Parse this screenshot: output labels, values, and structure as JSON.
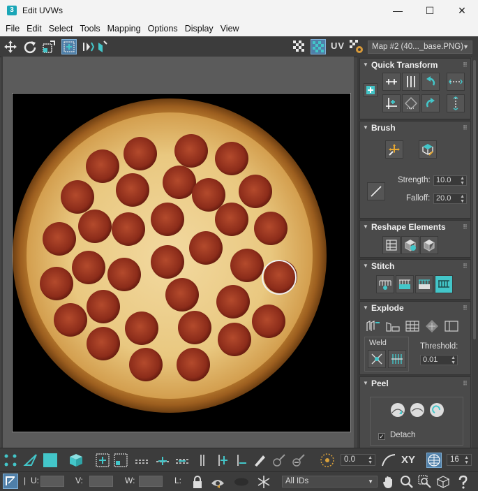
{
  "window": {
    "title": "Edit UVWs",
    "app_icon_glyph": "3",
    "minimize_glyph": "—",
    "maximize_glyph": "☐",
    "close_glyph": "✕"
  },
  "menu": [
    "File",
    "Edit",
    "Select",
    "Tools",
    "Mapping",
    "Options",
    "Display",
    "View"
  ],
  "toolbar_top": {
    "uv_label": "UV",
    "map_select": "Map #2 (40..._base.PNG)"
  },
  "panel": {
    "quick_transform": {
      "title": "Quick Transform"
    },
    "brush": {
      "title": "Brush",
      "strength_label": "Strength:",
      "strength_value": "10.0",
      "falloff_label": "Falloff:",
      "falloff_value": "20.0"
    },
    "reshape": {
      "title": "Reshape Elements"
    },
    "stitch": {
      "title": "Stitch"
    },
    "explode": {
      "title": "Explode",
      "weld_label": "Weld",
      "threshold_label": "Threshold:",
      "threshold_value": "0.01"
    },
    "peel": {
      "title": "Peel",
      "detach_label": "Detach",
      "detach_checked": true
    }
  },
  "bottom1": {
    "angle_value": "0.0",
    "xy_label": "XY",
    "grid_value": "16"
  },
  "bottom2": {
    "u_label": "U:",
    "v_label": "V:",
    "w_label": "W:",
    "l_label": "L:",
    "ids_select": "All IDs"
  },
  "colors": {
    "accent": "#43c6c9",
    "panel_bg": "#4a4a4a",
    "toolbar_bg": "#3c3c3c",
    "viewport_bg": "#5b5b5b"
  }
}
